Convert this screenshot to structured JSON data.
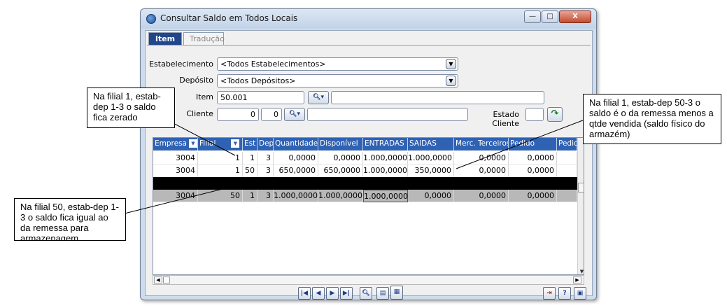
{
  "window": {
    "title": "Consultar Saldo em Todos Locais",
    "controls": {
      "minimize": "—",
      "maximize": "□",
      "close": "X"
    }
  },
  "tabs": [
    {
      "label": "Item",
      "active": true
    },
    {
      "label": "Tradução",
      "active": false
    }
  ],
  "form": {
    "estabelecimento_label": "Estabelecimento",
    "estabelecimento_value": "<Todos Estabelecimentos>",
    "deposito_label": "Depósito",
    "deposito_value": "<Todos Depósitos>",
    "item_label": "Item",
    "item_value": "50.001",
    "item_desc": "",
    "cliente_label": "Cliente",
    "cliente_value_1": "0",
    "cliente_value_2": "0",
    "cliente_desc": "",
    "estado_cliente_label": "Estado Cliente",
    "estado_cliente_value": ""
  },
  "grid": {
    "columns": [
      "Empresa",
      "Filial",
      "Est",
      "Dep",
      "Quantidade",
      "Disponível",
      "ENTRADAS",
      "SAIDAS",
      "Merc. Terceiros",
      "Pedido",
      "Pedido"
    ],
    "rows": [
      [
        "3004",
        "1",
        "1",
        "3",
        "0,0000",
        "0,0000",
        "1.000,0000",
        "1.000,0000",
        "0,0000",
        "0,0000",
        ""
      ],
      [
        "3004",
        "1",
        "50",
        "3",
        "650,0000",
        "650,0000",
        "1.000,0000",
        "350,0000",
        "0,0000",
        "0,0000",
        ""
      ],
      [
        "3004",
        "50",
        "1",
        "3",
        "1.000,0000",
        "1.000,0000",
        "1.000,0000",
        "0,0000",
        "0,0000",
        "0,0000",
        ""
      ]
    ]
  },
  "callouts": {
    "c1": "Na filial 1, estab-dep 1-3 o saldo fica zerado",
    "c2": "Na filial 1, estab-dep 50-3 o saldo é o da remessa menos a qtde vendida (saldo físico do armazém)",
    "c3": "Na filial 50, estab-dep 1-3 o saldo fica igual ao da remessa para armazenagem"
  },
  "icons": {
    "app": "app-icon",
    "search": "search-icon",
    "go": "go-arrow-icon",
    "first": "first-record-icon",
    "prev": "previous-record-icon",
    "next": "next-record-icon",
    "last": "last-record-icon",
    "find": "find-icon",
    "form": "form-view-icon",
    "grid": "grid-view-icon",
    "exit": "exit-icon",
    "help": "help-icon",
    "info": "info-icon"
  },
  "colors": {
    "header_blue": "#2f62b3",
    "tab_active": "#21468a",
    "window_frame": "#cfdcec",
    "close_red": "#c44c33"
  }
}
